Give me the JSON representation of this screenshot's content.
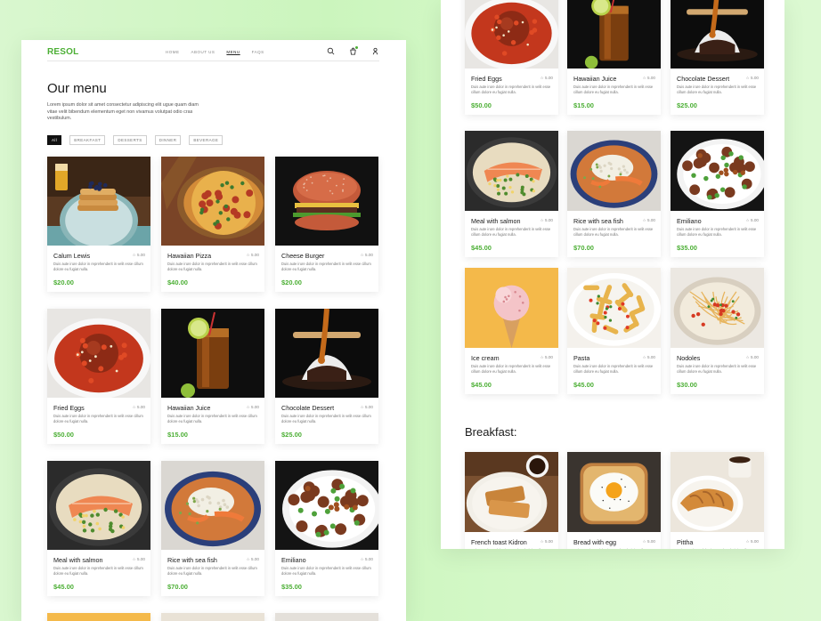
{
  "nav": {
    "logo": "RESOL",
    "links": [
      "HOME",
      "ABOUT US",
      "MENU",
      "FAQS"
    ],
    "active_index": 2,
    "icons": [
      "search-icon",
      "cart-icon",
      "user-icon"
    ]
  },
  "menu": {
    "title": "Our menu",
    "intro": "Lorem ipsum dolor sit amet consectetur adipiscing elit ugue quam diam vitae velit bibendum elementum eget non vivamus volutpat odio cras vestibulum.",
    "filters": [
      "All",
      "BREAKFAST",
      "DESSERTS",
      "DINNER",
      "BEVERAGE"
    ],
    "active_filter": 0
  },
  "description": "Duis aute irure dolor in reprehenderit in velit esse cillum dolore eu fugiat nulla.",
  "cards_left": [
    {
      "name": "Calum Lewis",
      "rating": "5.00",
      "price": "$20.00",
      "dish": "pancake"
    },
    {
      "name": "Hawaiian Pizza",
      "rating": "5.00",
      "price": "$40.00",
      "dish": "pizza"
    },
    {
      "name": "Cheese Burger",
      "rating": "5.00",
      "price": "$20.00",
      "dish": "burger"
    },
    {
      "name": "Fried Eggs",
      "rating": "5.00",
      "price": "$50.00",
      "dish": "meatball"
    },
    {
      "name": "Hawaiian Juice",
      "rating": "5.00",
      "price": "$15.00",
      "dish": "juice"
    },
    {
      "name": "Chocolate Dessert",
      "rating": "5.00",
      "price": "$25.00",
      "dish": "dessert"
    },
    {
      "name": "Meal with salmon",
      "rating": "5.00",
      "price": "$45.00",
      "dish": "salmon"
    },
    {
      "name": "Rice with sea fish",
      "rating": "5.00",
      "price": "$70.00",
      "dish": "rice"
    },
    {
      "name": "Emiliano",
      "rating": "5.00",
      "price": "$35.00",
      "dish": "meatballs"
    }
  ],
  "cards_right": [
    {
      "name": "Fried Eggs",
      "rating": "5.00",
      "price": "$50.00",
      "dish": "meatball"
    },
    {
      "name": "Hawaiian Juice",
      "rating": "5.00",
      "price": "$15.00",
      "dish": "juice"
    },
    {
      "name": "Chocolate Dessert",
      "rating": "5.00",
      "price": "$25.00",
      "dish": "dessert"
    },
    {
      "name": "Meal with salmon",
      "rating": "5.00",
      "price": "$45.00",
      "dish": "salmon"
    },
    {
      "name": "Rice with sea fish",
      "rating": "5.00",
      "price": "$70.00",
      "dish": "rice"
    },
    {
      "name": "Emiliano",
      "rating": "5.00",
      "price": "$35.00",
      "dish": "meatballs"
    },
    {
      "name": "Ice cream",
      "rating": "5.00",
      "price": "$45.00",
      "dish": "icecream"
    },
    {
      "name": "Pasta",
      "rating": "5.00",
      "price": "$45.00",
      "dish": "pasta"
    },
    {
      "name": "Nodoles",
      "rating": "5.00",
      "price": "$30.00",
      "dish": "noodles"
    }
  ],
  "breakfast": {
    "title": "Breakfast:",
    "cards": [
      {
        "name": "French toast Kidron",
        "rating": "5.00",
        "dish": "toast"
      },
      {
        "name": "Bread with egg",
        "rating": "5.00",
        "dish": "eggbread"
      },
      {
        "name": "Pittha",
        "rating": "5.00",
        "dish": "croissant"
      }
    ]
  },
  "colors": {
    "accent": "#4caf35",
    "background": "#cdf5bf"
  }
}
